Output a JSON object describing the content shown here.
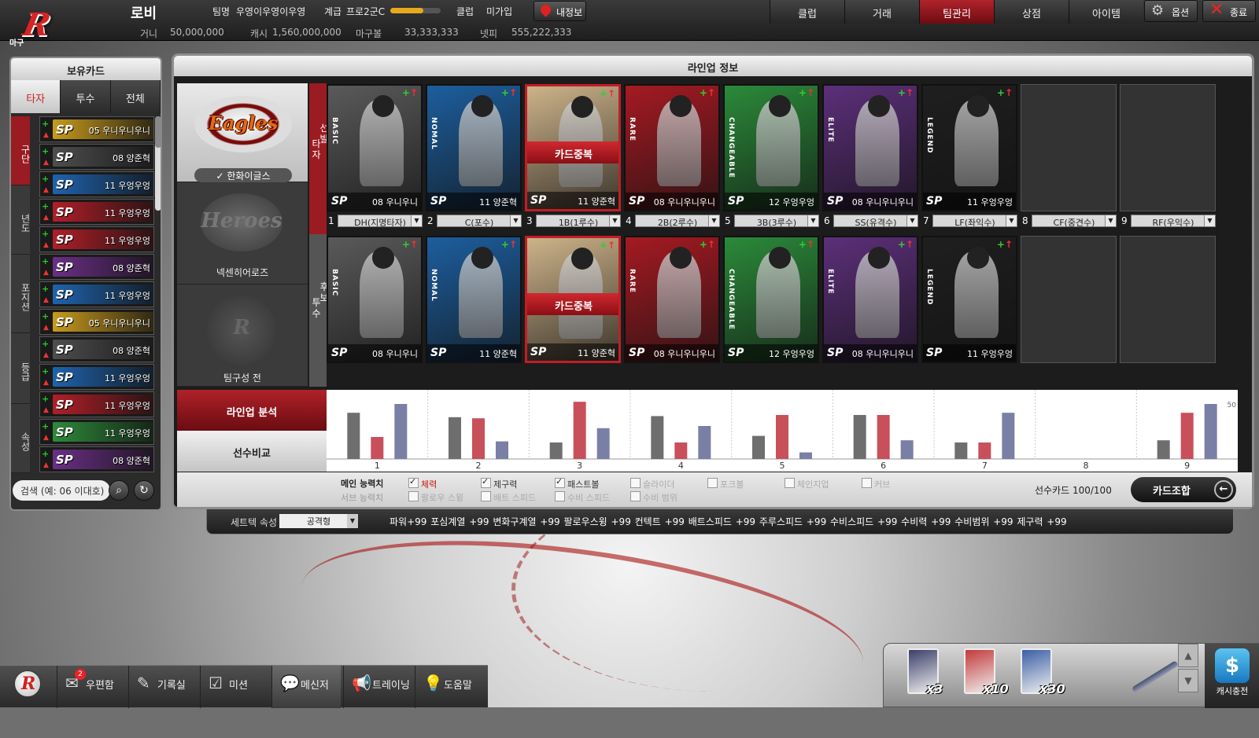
{
  "header": {
    "logo_small": "마구",
    "logo_text": "R",
    "screen_title": "로비",
    "team_label": "팀명",
    "team_value": "우영이우영이우영",
    "rank_label": "계급",
    "rank_value": "프로2군C",
    "rank_progress": 0.65,
    "club_label": "클럽",
    "club_value": "미가입",
    "myinfo_button": "내정보",
    "money_label": "거니",
    "money_value": "50,000,000",
    "cash_label": "캐시",
    "cash_value": "1,560,000,000",
    "magu_label": "마구볼",
    "magu_value": "33,333,333",
    "netpi_label": "넷피",
    "netpi_value": "555,222,333",
    "tabs": [
      "클럽",
      "거래",
      "팀관리",
      "상점",
      "아이템"
    ],
    "active_tab": "팀관리",
    "options_button": "옵션",
    "exit_button": "종료"
  },
  "left_panel": {
    "title": "보유카드",
    "tabs": [
      "타자",
      "투수",
      "전체"
    ],
    "active_tab": "타자",
    "categories": [
      "구단",
      "년도",
      "포지션",
      "등급",
      "속성"
    ],
    "cards": [
      {
        "sp": "SP",
        "name": "05 우니우니우니",
        "color": "#c89a1e"
      },
      {
        "sp": "SP",
        "name": "08 양준혁",
        "color": "#4e4e4e"
      },
      {
        "sp": "SP",
        "name": "11 우엉우엉",
        "color": "#1f63ad"
      },
      {
        "sp": "SP",
        "name": "11 우엉우엉",
        "color": "#b01f28"
      },
      {
        "sp": "SP",
        "name": "11 우엉우엉",
        "color": "#b01f28"
      },
      {
        "sp": "SP",
        "name": "08 양준혁",
        "color": "#6b2f86"
      },
      {
        "sp": "SP",
        "name": "11 우엉우엉",
        "color": "#1f63ad"
      },
      {
        "sp": "SP",
        "name": "05 우니우니우니",
        "color": "#c89a1e"
      },
      {
        "sp": "SP",
        "name": "08 양준혁",
        "color": "#4e4e4e"
      },
      {
        "sp": "SP",
        "name": "11 우엉우엉",
        "color": "#1f63ad"
      },
      {
        "sp": "SP",
        "name": "11 우엉우엉",
        "color": "#b01f28"
      },
      {
        "sp": "SP",
        "name": "11 우엉우엉",
        "color": "#2e8a3a"
      },
      {
        "sp": "SP",
        "name": "08 양준혁",
        "color": "#6b2f86"
      }
    ],
    "search_placeholder": "검색 (예: 06 이대호)"
  },
  "main": {
    "title": "라인업 정보",
    "teams": [
      {
        "name": "한화이글스",
        "logo": "Eagles",
        "selected": true
      },
      {
        "name": "넥센히어로즈",
        "logo": "Heroes",
        "selected": false
      },
      {
        "name": "팀구성 전",
        "logo": "R",
        "selected": false
      }
    ],
    "side_labels": {
      "batter": "타자",
      "starter": "선발",
      "pitcher": "투수",
      "bench": "후보"
    },
    "duplicate_label": "카드중복",
    "lineup": [
      {
        "num": "1",
        "pos": "DH(지명타자)",
        "grade": "BASIC",
        "sp": "SP",
        "name": "08 우니우니",
        "bg": "#5a5a5a",
        "team": "ARS"
      },
      {
        "num": "2",
        "pos": "C(포수)",
        "grade": "NOMAL",
        "sp": "SP",
        "name": "11 양준혁",
        "bg": "#1d5e9e",
        "team": "JETS"
      },
      {
        "num": "3",
        "pos": "1B(1루수)",
        "grade": "",
        "sp": "SP",
        "name": "11 양준혁",
        "bg": "#cdb38a",
        "team": "",
        "dup": true
      },
      {
        "num": "4",
        "pos": "2B(2루수)",
        "grade": "RARE",
        "sp": "SP",
        "name": "08 우니우니우니",
        "bg": "#a51a22",
        "team": ""
      },
      {
        "num": "5",
        "pos": "3B(3루수)",
        "grade": "CHANGEABLE",
        "sp": "SP",
        "name": "12 우엉우엉",
        "bg": "#2b8a3a",
        "team": ""
      },
      {
        "num": "6",
        "pos": "SS(유격수)",
        "grade": "ELITE",
        "sp": "SP",
        "name": "08 우니우니우니",
        "bg": "#5c2f7a",
        "team": ""
      },
      {
        "num": "7",
        "pos": "LF(좌익수)",
        "grade": "LEGEND",
        "sp": "SP",
        "name": "11 우엉우엉",
        "bg": "#1f1f1f",
        "team": ""
      },
      {
        "num": "8",
        "pos": "CF(중견수)",
        "empty": true
      },
      {
        "num": "9",
        "pos": "RF(우익수)",
        "empty": true
      }
    ],
    "bench": [
      {
        "grade": "BASIC",
        "sp": "SP",
        "name": "08 우니우니",
        "bg": "#5a5a5a"
      },
      {
        "grade": "NOMAL",
        "sp": "SP",
        "name": "11 양준혁",
        "bg": "#1d5e9e"
      },
      {
        "grade": "",
        "sp": "SP",
        "name": "11 양준혁",
        "bg": "#cdb38a",
        "dup": true
      },
      {
        "grade": "RARE",
        "sp": "SP",
        "name": "08 우니우니우니",
        "bg": "#a51a22"
      },
      {
        "grade": "CHANGEABLE",
        "sp": "SP",
        "name": "12 우엉우엉",
        "bg": "#2b8a3a"
      },
      {
        "grade": "ELITE",
        "sp": "SP",
        "name": "08 우니우니우니",
        "bg": "#5c2f7a"
      },
      {
        "grade": "LEGEND",
        "sp": "SP",
        "name": "11 우엉우엉",
        "bg": "#1f1f1f"
      },
      {
        "empty": true
      },
      {
        "empty": true
      }
    ],
    "pages": [
      "1",
      "2",
      "3"
    ],
    "analysis_tab": "라인업 분석",
    "compare_tab": "선수비교",
    "main_stat_label": "메인 능력치",
    "sub_stat_label": "서브 능력치",
    "main_stats": [
      {
        "label": "체력",
        "checked": true,
        "red": true
      },
      {
        "label": "제구력",
        "checked": true
      },
      {
        "label": "패스트볼",
        "checked": true
      },
      {
        "label": "슬라이더",
        "checked": false
      },
      {
        "label": "포크볼",
        "checked": false
      },
      {
        "label": "체인지업",
        "checked": false
      },
      {
        "label": "커브",
        "checked": false
      }
    ],
    "sub_stats": [
      "팔로우 스윙",
      "배트 스피드",
      "수비 스피드",
      "수비 범위"
    ],
    "card_count": "선수카드 100/100",
    "combine_button": "카드조합"
  },
  "chart_data": {
    "type": "bar",
    "categories": [
      "1",
      "2",
      "3",
      "4",
      "5",
      "6",
      "7",
      "8",
      "9"
    ],
    "series": [
      {
        "color": "#6e6e6e",
        "values": [
          42,
          38,
          15,
          39,
          21,
          40,
          15,
          0,
          17
        ]
      },
      {
        "color": "#c8505a",
        "values": [
          20,
          37,
          52,
          15,
          40,
          40,
          15,
          0,
          42
        ]
      },
      {
        "color": "#7a7fa6",
        "values": [
          50,
          16,
          28,
          30,
          6,
          17,
          42,
          0,
          50
        ]
      }
    ],
    "ylim": [
      0,
      60
    ],
    "y_tick_label": "50"
  },
  "settech": {
    "label": "세트텍 속성",
    "select": "공격형",
    "stats": "파워+99   포심계열 +99   변화구계열 +99   팔로우스윙 +99   컨텍트 +99   배트스피드 +99   주루스피드 +99   수비스피드 +99   수비력 +99   수비범위 +99   제구력 +99"
  },
  "bottom": {
    "items": [
      {
        "label": "우편함",
        "icon": "✉",
        "badge": "2"
      },
      {
        "label": "기록실",
        "icon": "✎"
      },
      {
        "label": "미션",
        "icon": "☑"
      },
      {
        "label": "메신저",
        "icon": "💬"
      },
      {
        "label": "트레이닝",
        "icon": "📢"
      },
      {
        "label": "도움말",
        "icon": "💡"
      }
    ],
    "packs": [
      {
        "count": "x3",
        "color": "#3b3f6a"
      },
      {
        "count": "x10",
        "color": "#c43a3a"
      },
      {
        "count": "x30",
        "color": "#3a5fa5"
      }
    ],
    "cash_charge": "캐시충전"
  }
}
